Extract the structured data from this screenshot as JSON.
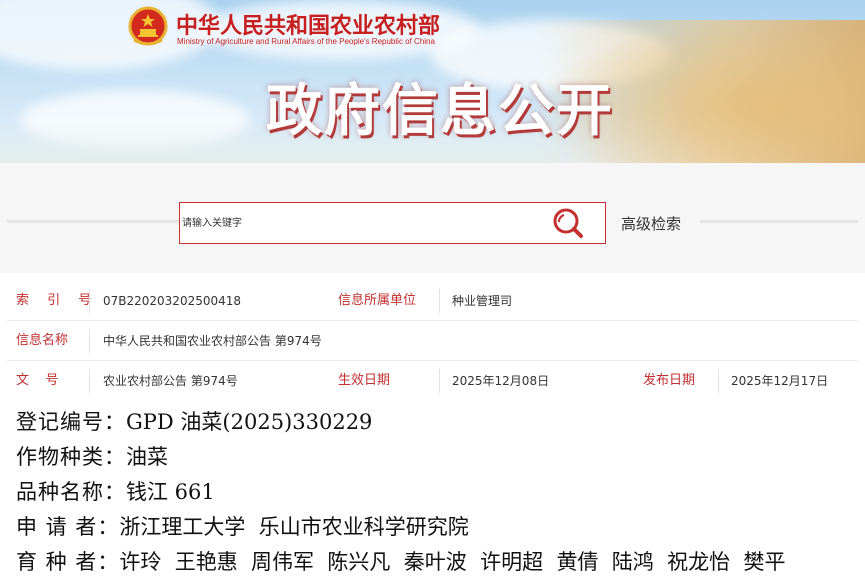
{
  "header": {
    "ministry_cn": "中华人民共和国农业农村部",
    "ministry_en": "Ministry of Agriculture and Rural Affairs of the People's Republic of China",
    "banner_title": "政府信息公开",
    "emblem_icon": "national-emblem-icon",
    "accent_color": "#c81e1e"
  },
  "search": {
    "placeholder": "请输入关键字",
    "value": "",
    "search_icon": "search-icon",
    "advanced_label": "高级检索"
  },
  "meta": {
    "index_label": "索 引 号",
    "index_value": "07B220203202500418",
    "unit_label": "信息所属单位",
    "unit_value": "种业管理司",
    "name_label": "信息名称",
    "name_value": "中华人民共和国农业农村部公告 第974号",
    "doc_label": "文    号",
    "doc_value": "农业农村部公告 第974号",
    "effective_label": "生效日期",
    "effective_value": "2025年12月08日",
    "publish_label": "发布日期",
    "publish_value": "2025年12月17日"
  },
  "document": {
    "reg_key": "登记编号：",
    "reg_value": "GPD 油菜(2025)330229",
    "crop_key": "作物种类：",
    "crop_value": "油菜",
    "variety_key": "品种名称：",
    "variety_value": "钱江 661",
    "applicant_key": "申 请 者：",
    "applicant_value": "浙江理工大学  乐山市农业科学研究院",
    "breeder_key": "育 种 者：",
    "breeder_value": "许玲  王艳惠  周伟军  陈兴凡  秦叶波  许明超  黄倩  陆鸿  祝龙怡  樊平"
  }
}
